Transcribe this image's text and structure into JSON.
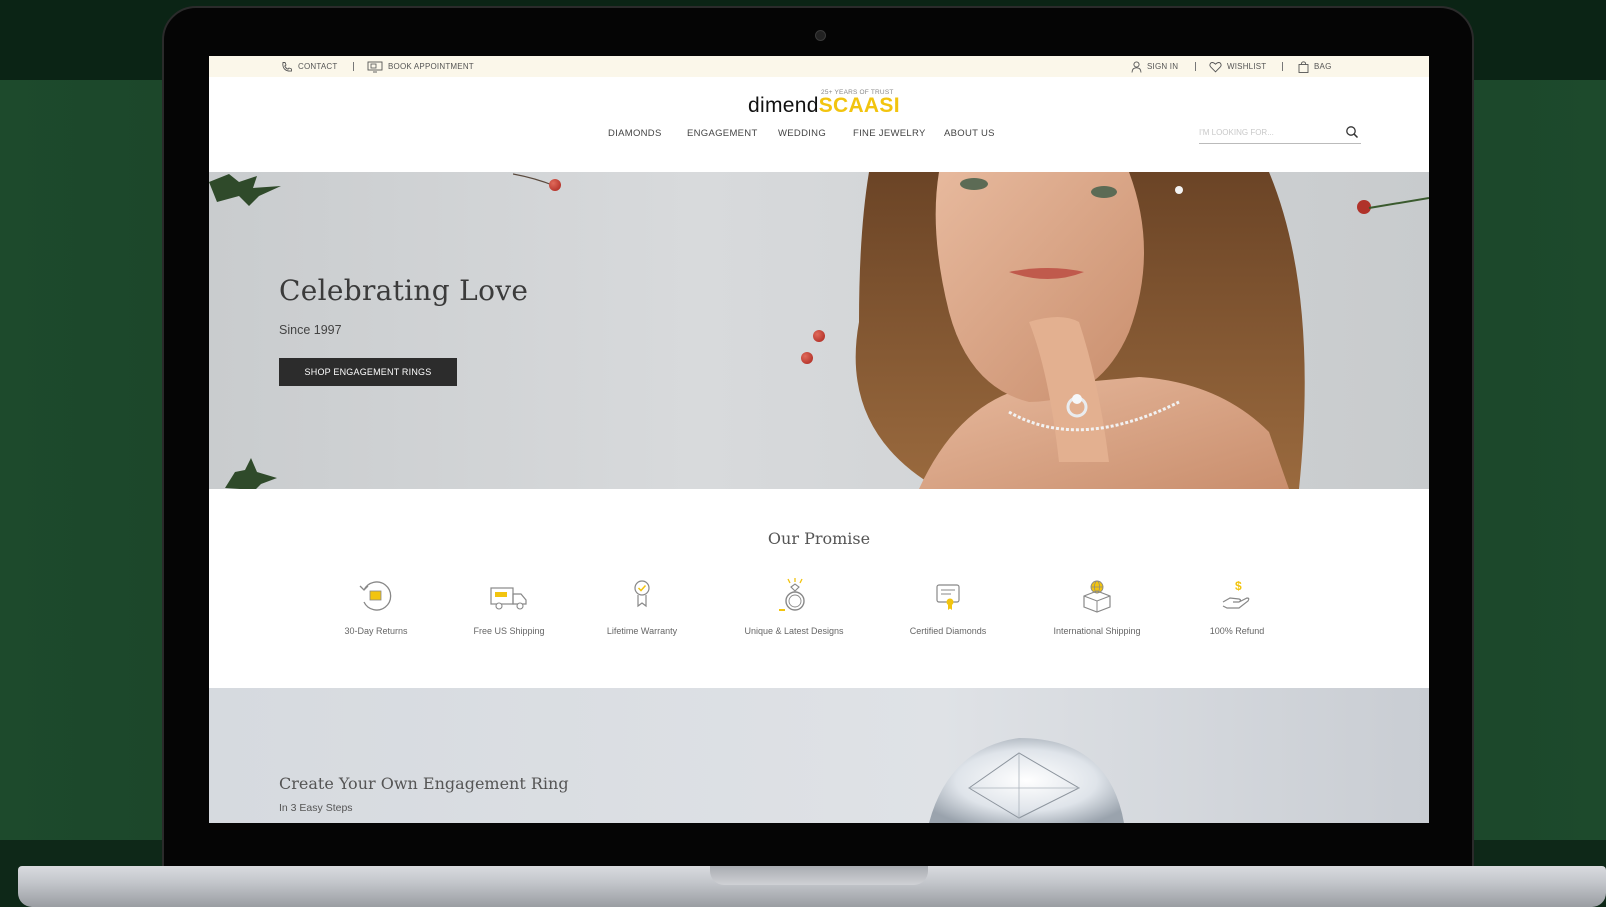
{
  "topbar": {
    "contact": "CONTACT",
    "book": "BOOK APPOINTMENT",
    "signin": "SIGN IN",
    "wishlist": "WISHLIST",
    "bag": "BAG"
  },
  "logo": {
    "tagline": "25+ YEARS OF TRUST",
    "word1": "dimend",
    "word2": "SCAASI"
  },
  "nav": {
    "items": [
      "DIAMONDS",
      "ENGAGEMENT",
      "WEDDING",
      "FINE JEWELRY",
      "ABOUT US"
    ]
  },
  "search": {
    "placeholder": "I'M LOOKING FOR..."
  },
  "hero": {
    "title": "Celebrating Love",
    "subtitle": "Since 1997",
    "button": "SHOP ENGAGEMENT RINGS"
  },
  "promise": {
    "title": "Our Promise",
    "items": [
      {
        "label": "30-Day Returns",
        "icon": "returns-icon"
      },
      {
        "label": "Free US Shipping",
        "icon": "shipping-truck-icon"
      },
      {
        "label": "Lifetime Warranty",
        "icon": "warranty-badge-icon"
      },
      {
        "label": "Unique & Latest Designs",
        "icon": "ring-icon"
      },
      {
        "label": "Certified Diamonds",
        "icon": "certificate-icon"
      },
      {
        "label": "International Shipping",
        "icon": "globe-box-icon"
      },
      {
        "label": "100% Refund",
        "icon": "refund-hand-icon"
      }
    ]
  },
  "create": {
    "title": "Create Your Own Engagement Ring",
    "subtitle": "In 3 Easy Steps"
  },
  "colors": {
    "accent": "#f2c40f",
    "topbar_bg": "#fbf7ea",
    "button_bg": "#2c2c2c",
    "frame_green": "#1d4a2c"
  }
}
